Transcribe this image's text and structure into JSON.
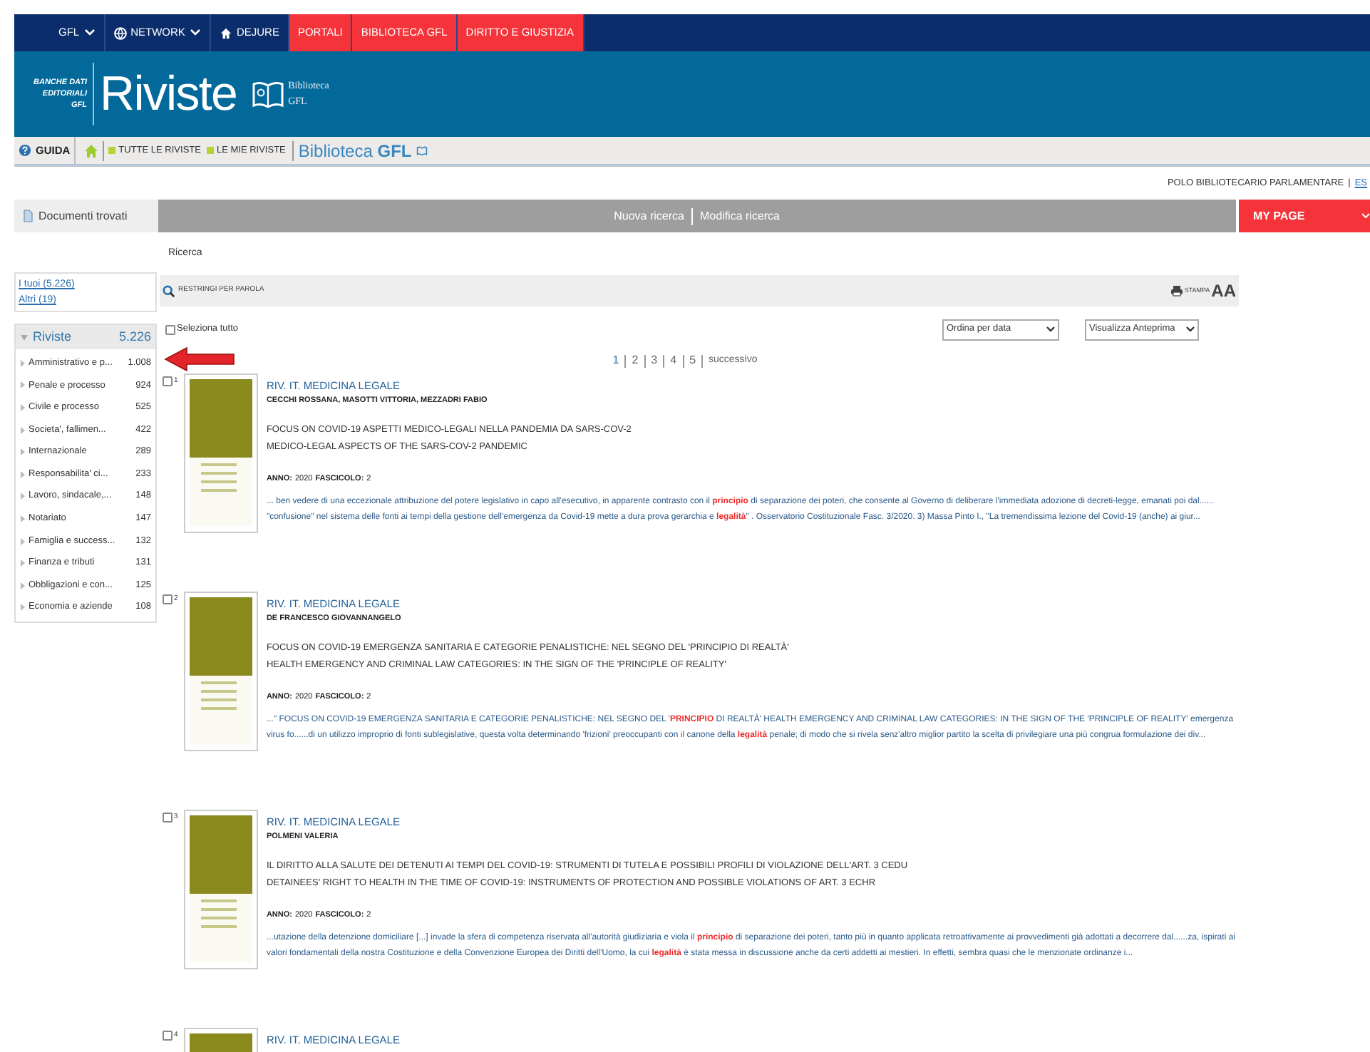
{
  "top_nav": [
    {
      "label": "GFL",
      "kind": "dropdown"
    },
    {
      "label": "NETWORK",
      "kind": "network"
    },
    {
      "label": "DEJURE",
      "kind": "home"
    },
    {
      "label": "PORTALI",
      "kind": "highlight"
    },
    {
      "label": "BIBLIOTECA GFL",
      "kind": "highlight"
    },
    {
      "label": "DIRITTO E GIUSTIZIA",
      "kind": "highlight"
    }
  ],
  "header": {
    "brand": [
      "BANCHE DATI",
      "EDITORIALI",
      "GFL"
    ],
    "title": "Riviste",
    "library": [
      "Biblioteca",
      "GFL"
    ]
  },
  "toolbar": {
    "guide": "GUIDA",
    "links": [
      "TUTTE LE RIVISTE",
      "LE MIE RIVISTE"
    ],
    "library_prefix": "Biblioteca",
    "library_suffix": "GFL"
  },
  "user_line": {
    "org": "POLO BIBLIOTECARIO PARLAMENTARE",
    "separator": "|",
    "link": "ES"
  },
  "tab_bar": {
    "left": "Documenti trovati",
    "actions": [
      "Nuova ricerca",
      "Modifica ricerca"
    ],
    "my_page": "MY PAGE"
  },
  "breadcrumb": "Ricerca",
  "scope_links": [
    "I tuoi (5.226)",
    "Altri (19)"
  ],
  "filter_bar": {
    "restrict": "RESTRINGI PER PAROLA",
    "print": "STAMPA",
    "font_size": "AA"
  },
  "facet": {
    "title": "Riviste",
    "count": "5.226",
    "expanded": true,
    "items": [
      {
        "label": "Amministrativo e p...",
        "count": "1.008"
      },
      {
        "label": "Penale e processo",
        "count": "924"
      },
      {
        "label": "Civile e processo",
        "count": "525"
      },
      {
        "label": "Societa', fallimen...",
        "count": "422"
      },
      {
        "label": "Internazionale",
        "count": "289"
      },
      {
        "label": "Responsabilita' ci...",
        "count": "233"
      },
      {
        "label": "Lavoro, sindacale,...",
        "count": "148"
      },
      {
        "label": "Notariato",
        "count": "147"
      },
      {
        "label": "Famiglia e success...",
        "count": "132"
      },
      {
        "label": "Finanza e tributi",
        "count": "131"
      },
      {
        "label": "Obbligazioni e con...",
        "count": "125"
      },
      {
        "label": "Economia e aziende",
        "count": "108"
      }
    ]
  },
  "select_all": {
    "label": "Seleziona tutto",
    "checked": false
  },
  "sort_select": "Ordina per data",
  "view_select": "Visualizza Anteprima",
  "pagination": {
    "pages": [
      {
        "label": "1",
        "selected": true
      },
      {
        "label": "2",
        "selected": false
      },
      {
        "label": "3",
        "selected": false
      },
      {
        "label": "4",
        "selected": false
      },
      {
        "label": "5",
        "selected": false
      }
    ],
    "next": "successivo"
  },
  "results": [
    {
      "number": "1",
      "checked": false,
      "journal": "RIV. IT. MEDICINA LEGALE",
      "authors": "CECCHI ROSSANA, MASOTTI VITTORIA, MEZZADRI FABIO",
      "titles": [
        "FOCUS ON COVID-19 ASPETTI MEDICO-LEGALI NELLA PANDEMIA DA SARS-COV-2",
        "MEDICO-LEGAL ASPECTS OF THE SARS-COV-2 PANDEMIC"
      ],
      "anno_label": "ANNO:",
      "anno": "2020",
      "fascicolo_label": "FASCICOLO:",
      "fascicolo": "2",
      "excerpt": "... ben vedere di una eccezionale attribuzione del potere legislativo in capo all'esecutivo, in apparente contrasto con il **principio** di separazione dei poteri, che consente al Governo di deliberare l'immediata adozione di decreti-legge, emanati poi dal...... \"confusione\" nel sistema delle fonti ai tempi della gestione dell'emergenza da Covid-19 mette a dura prova gerarchia e **legalità**\" . Osservatorio Costituzionale Fasc. 3/2020. 3) Massa Pinto I., \"La tremendissima lezione del Covid-19 (anche) ai giur..."
    },
    {
      "number": "2",
      "checked": false,
      "journal": "RIV. IT. MEDICINA LEGALE",
      "authors": "DE FRANCESCO GIOVANNANGELO",
      "titles": [
        "FOCUS ON COVID-19 EMERGENZA SANITARIA E CATEGORIE PENALISTICHE: NEL SEGNO DEL 'PRINCIPIO DI REALTÀ'",
        "HEALTH EMERGENCY AND CRIMINAL LAW CATEGORIES: IN THE SIGN OF THE 'PRINCIPLE OF REALITY'"
      ],
      "anno_label": "ANNO:",
      "anno": "2020",
      "fascicolo_label": "FASCICOLO:",
      "fascicolo": "2",
      "excerpt": "...\" FOCUS ON COVID-19 EMERGENZA SANITARIA E CATEGORIE PENALISTICHE: NEL SEGNO DEL '**PRINCIPIO** DI REALTÀ' HEALTH EMERGENCY AND CRIMINAL LAW CATEGORIES: IN THE SIGN OF THE 'PRINCIPLE OF REALITY' emergenza virus fo......di un utilizzo improprio di fonti sublegislative, questa volta determinando 'frizioni' preoccupanti con il canone della **legalità** penale; di modo che si rivela senz'altro miglior partito la scelta di privilegiare una più congrua formulazione dei div..."
    },
    {
      "number": "3",
      "checked": false,
      "journal": "RIV. IT. MEDICINA LEGALE",
      "authors": "POLMENI VALERIA",
      "titles": [
        "IL DIRITTO ALLA SALUTE DEI DETENUTI AI TEMPI DEL COVID-19: STRUMENTI DI TUTELA E POSSIBILI PROFILI DI VIOLAZIONE DELL'ART. 3 CEDU",
        "DETAINEES' RIGHT TO HEALTH IN THE TIME OF COVID-19: INSTRUMENTS OF PROTECTION AND POSSIBLE VIOLATIONS OF ART. 3 ECHR"
      ],
      "anno_label": "ANNO:",
      "anno": "2020",
      "fascicolo_label": "FASCICOLO:",
      "fascicolo": "2",
      "excerpt": "...utazione della detenzione domiciliare [...] invade la sfera di competenza riservata all'autorità giudiziaria e viola il **principio** di separazione dei poteri, tanto più in quanto applicata retroattivamente ai provvedimenti già adottati a decorrere dal......za, ispirati ai valori fondamentali della nostra Costituzione e della Convenzione Europea dei Diritti dell'Uomo, la cui **legalità** è stata messa in discussione anche da certi addetti ai mestieri. In effetti, sembra quasi che le menzionate ordinanze i..."
    },
    {
      "number": "4",
      "checked": false,
      "journal": "RIV. IT. MEDICINA LEGALE"
    }
  ]
}
